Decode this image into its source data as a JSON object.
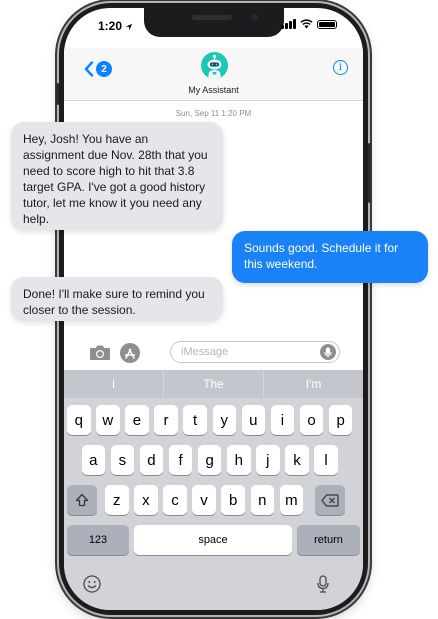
{
  "status": {
    "time": "1:20"
  },
  "nav": {
    "back_count": "2",
    "contact_name": "My Assistant"
  },
  "timestamp": "Sun, Sep 11 1:20 PM",
  "messages": [
    {
      "from": "assistant",
      "text": "Hey, Josh! You have an assignment due Nov. 28th that you need to score high to hit that 3.8 target GPA. I've got a good history tutor, let me know it you need any help."
    },
    {
      "from": "user",
      "text": "Sounds good. Schedule it for this weekend."
    },
    {
      "from": "assistant",
      "text": "Done! I'll make sure to remind you closer to the session."
    }
  ],
  "input": {
    "placeholder": "iMessage"
  },
  "keyboard": {
    "suggestions": [
      "I",
      "The",
      "I'm"
    ],
    "row1": [
      "q",
      "w",
      "e",
      "r",
      "t",
      "y",
      "u",
      "i",
      "o",
      "p"
    ],
    "row2": [
      "a",
      "s",
      "d",
      "f",
      "g",
      "h",
      "j",
      "k",
      "l"
    ],
    "row3": [
      "z",
      "x",
      "c",
      "v",
      "b",
      "n",
      "m"
    ],
    "numbers_label": "123",
    "space_label": "space",
    "return_label": "return"
  },
  "colors": {
    "accent": "#1a82f7",
    "incoming": "#e6e6ea",
    "keyboard_bg": "#d1d3d9"
  },
  "icons": [
    "back-chevron-icon",
    "bot-avatar",
    "info-icon",
    "camera-icon",
    "app-store-icon",
    "microphone-icon",
    "shift-icon",
    "delete-icon",
    "emoji-icon",
    "dictation-icon"
  ]
}
